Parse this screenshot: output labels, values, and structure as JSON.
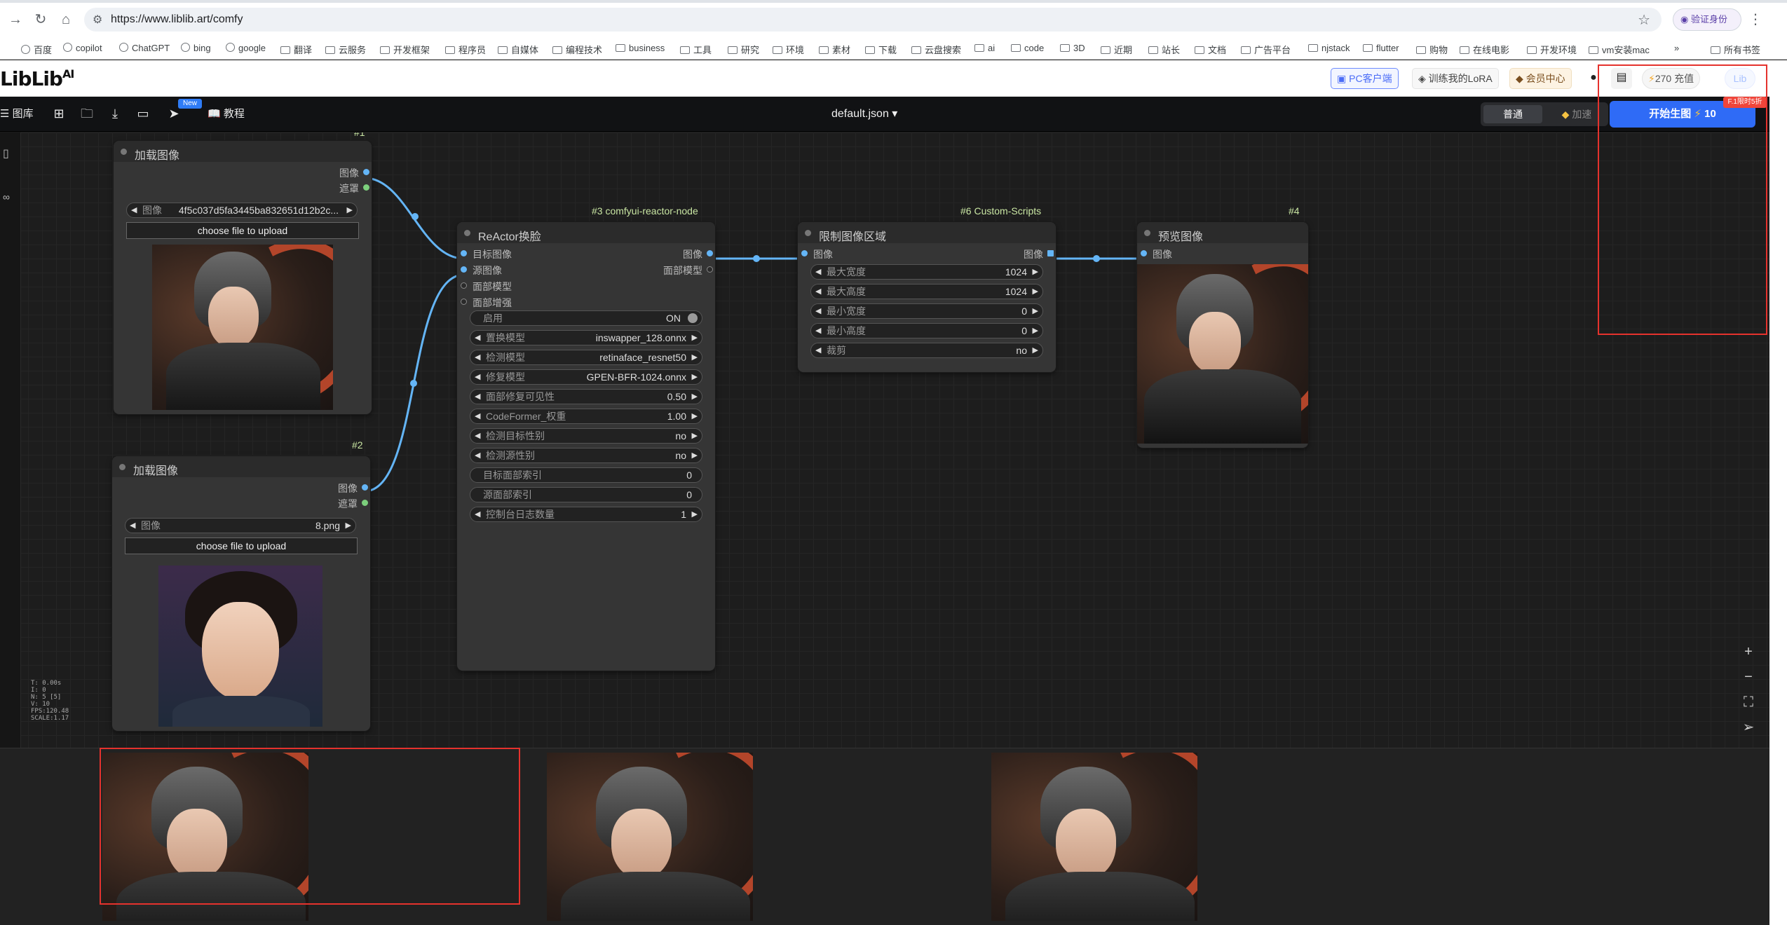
{
  "browser": {
    "url": "https://www.liblib.art/comfy",
    "verify_label": "验证身份",
    "bookmarks": [
      "百度",
      "copilot",
      "ChatGPT",
      "bing",
      "google",
      "翻译",
      "云服务",
      "开发框架",
      "程序员",
      "自媒体",
      "编程技术",
      "business",
      "工具",
      "研究",
      "环境",
      "素材",
      "下载",
      "云盘搜索",
      "ai",
      "code",
      "3D",
      "近期",
      "站长",
      "文档",
      "广告平台",
      "njstack",
      "flutter",
      "购物",
      "在线电影",
      "开发环境",
      "vm安装mac"
    ],
    "bookmarks_more": "»",
    "all_bookmarks": "所有书签"
  },
  "site": {
    "logo": "LibLib",
    "logo_suffix": "AI",
    "pc_client": "PC客户端",
    "train_lora": "训练我的LoRA",
    "vip_center": "会员中心",
    "credits": "270 充值",
    "avatar_text": "Lib"
  },
  "toolbar": {
    "library": "图库",
    "new_badge": "New",
    "tutorial": "教程",
    "workflow_name": "default.json",
    "mode_normal": "普通",
    "mode_fast": "加速",
    "generate": "开始生图",
    "generate_cost": "10",
    "promo": "F.1限时5折"
  },
  "nodes": {
    "load1": {
      "id": "#1",
      "title": "加载图像",
      "outputs": [
        "图像",
        "遮罩"
      ],
      "widget_label": "图像",
      "widget_value": "4f5c037d5fa3445ba832651d12b2c...",
      "upload": "choose file to upload"
    },
    "load2": {
      "id": "#2",
      "title": "加载图像",
      "outputs": [
        "图像",
        "遮罩"
      ],
      "widget_label": "图像",
      "widget_value": "8.png",
      "upload": "choose file to upload"
    },
    "reactor": {
      "id": "#3 comfyui-reactor-node",
      "title": "ReActor换脸",
      "inputs": [
        "目标图像",
        "源图像",
        "面部模型",
        "面部增强"
      ],
      "outputs": [
        "图像",
        "面部模型"
      ],
      "enable_label": "启用",
      "enable_value": "ON",
      "widgets": [
        {
          "label": "置换模型",
          "value": "inswapper_128.onnx"
        },
        {
          "label": "检测模型",
          "value": "retinaface_resnet50"
        },
        {
          "label": "修复模型",
          "value": "GPEN-BFR-1024.onnx"
        },
        {
          "label": "面部修复可见性",
          "value": "0.50"
        },
        {
          "label": "CodeFormer_权重",
          "value": "1.00"
        },
        {
          "label": "检测目标性别",
          "value": "no"
        },
        {
          "label": "检测源性别",
          "value": "no"
        },
        {
          "label": "目标面部索引",
          "value": "0"
        },
        {
          "label": "源面部索引",
          "value": "0"
        },
        {
          "label": "控制台日志数量",
          "value": "1"
        }
      ]
    },
    "limit": {
      "id": "#6 Custom-Scripts",
      "title": "限制图像区域",
      "input": "图像",
      "output": "图像",
      "widgets": [
        {
          "label": "最大宽度",
          "value": "1024"
        },
        {
          "label": "最大高度",
          "value": "1024"
        },
        {
          "label": "最小宽度",
          "value": "0"
        },
        {
          "label": "最小高度",
          "value": "0"
        },
        {
          "label": "裁剪",
          "value": "no"
        }
      ]
    },
    "preview": {
      "id": "#4",
      "title": "预览图像",
      "input": "图像"
    }
  },
  "stats": [
    "T: 0.00s",
    "I: 0",
    "N: 5 [5]",
    "V: 10",
    "FPS:120.48",
    "SCALE:1.17"
  ],
  "colors": {
    "accent": "#2f6bf6",
    "link": "#64b5f6",
    "node_bg": "#353535",
    "highlight": "#e5322d"
  }
}
